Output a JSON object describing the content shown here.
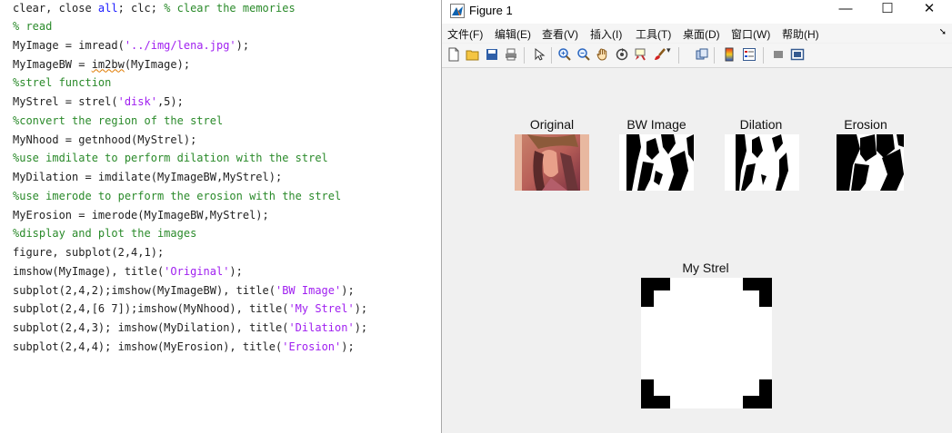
{
  "editor": {
    "lines": [
      [
        {
          "t": "clear, close "
        },
        {
          "t": "all",
          "c": "kw"
        },
        {
          "t": "; clc; "
        },
        {
          "t": "% clear the memories",
          "c": "cm"
        }
      ],
      [
        {
          "t": "% read",
          "c": "cm"
        }
      ],
      [
        {
          "t": "MyImage = imread("
        },
        {
          "t": "'../img/lena.jpg'",
          "c": "st"
        },
        {
          "t": ");"
        }
      ],
      [
        {
          "t": "MyImageBW = "
        },
        {
          "t": "im2bw",
          "c": "fn-under"
        },
        {
          "t": "(MyImage);"
        }
      ],
      [
        {
          "t": "%strel function",
          "c": "cm"
        }
      ],
      [
        {
          "t": "MyStrel = strel("
        },
        {
          "t": "'disk'",
          "c": "st"
        },
        {
          "t": ",5);"
        }
      ],
      [
        {
          "t": "%convert the region of the strel",
          "c": "cm"
        }
      ],
      [
        {
          "t": "MyNhood = getnhood(MyStrel);"
        }
      ],
      [
        {
          "t": "%use imdilate to perform dilation with the strel",
          "c": "cm"
        }
      ],
      [
        {
          "t": "MyDilation = imdilate(MyImageBW,MyStrel);"
        }
      ],
      [
        {
          "t": "%use imerode to perform the erosion with the strel",
          "c": "cm"
        }
      ],
      [
        {
          "t": "MyErosion = imerode(MyImageBW,MyStrel);"
        }
      ],
      [
        {
          "t": "%display and plot the images",
          "c": "cm"
        }
      ],
      [
        {
          "t": "figure, subplot(2,4,1);"
        }
      ],
      [
        {
          "t": "imshow(MyImage), title("
        },
        {
          "t": "'Original'",
          "c": "st"
        },
        {
          "t": ");"
        }
      ],
      [
        {
          "t": "subplot(2,4,2);imshow(MyImageBW), title("
        },
        {
          "t": "'BW Image'",
          "c": "st"
        },
        {
          "t": ");"
        }
      ],
      [
        {
          "t": "subplot(2,4,[6 7]);imshow(MyNhood), title("
        },
        {
          "t": "'My Strel'",
          "c": "st"
        },
        {
          "t": ");"
        }
      ],
      [
        {
          "t": "subplot(2,4,3); imshow(MyDilation), title("
        },
        {
          "t": "'Dilation'",
          "c": "st"
        },
        {
          "t": ");"
        }
      ],
      [
        {
          "t": "subplot(2,4,4); imshow(MyErosion), title("
        },
        {
          "t": "'Erosion'",
          "c": "st"
        },
        {
          "t": ");"
        }
      ]
    ]
  },
  "figure": {
    "title": "Figure 1",
    "icon": "matlab-icon",
    "controls": {
      "minimize": "—",
      "maximize": "☐",
      "close": "✕"
    },
    "menu": [
      "文件(F)",
      "编辑(E)",
      "查看(V)",
      "插入(I)",
      "工具(T)",
      "桌面(D)",
      "窗口(W)",
      "帮助(H)"
    ],
    "toolbar": [
      "new-figure-icon",
      "open-icon",
      "save-icon",
      "print-icon",
      "pointer-icon",
      "zoom-in-icon",
      "zoom-out-icon",
      "pan-icon",
      "rotate-icon",
      "data-cursor-icon",
      "brush-icon",
      "link-icon",
      "colorbar-icon",
      "legend-icon",
      "hide-tools-icon",
      "dock-icon"
    ],
    "subplots": {
      "original": "Original",
      "bw": "BW Image",
      "dilation": "Dilation",
      "erosion": "Erosion",
      "strel": "My Strel"
    }
  },
  "colors": {
    "comment": "#2a8a2a",
    "keyword": "#1a1aff",
    "string": "#a020f0"
  }
}
